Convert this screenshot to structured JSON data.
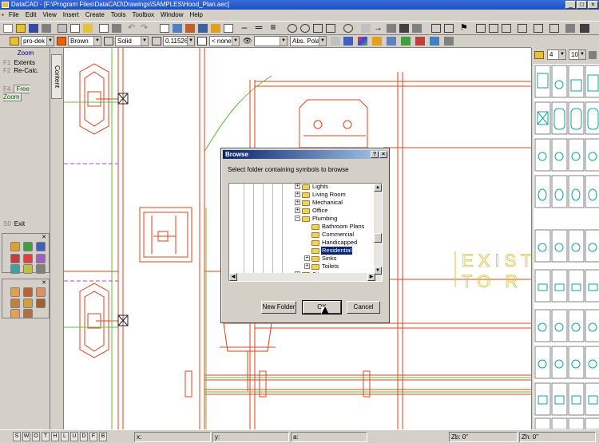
{
  "window": {
    "title": "DataCAD - [F:\\Program Files\\DataCAD\\Drawings\\SAMPLES\\Hood_Plan.aec]"
  },
  "menu": [
    "File",
    "Edit",
    "View",
    "Insert",
    "Create",
    "Tools",
    "Toolbox",
    "Window",
    "Help"
  ],
  "toolbar2": {
    "layer": "pro-dek",
    "color": "Brown",
    "linetype": "Solid",
    "lineweight": "0.115263",
    "fill": "< none >",
    "unnamed": "",
    "coords": "Abs. Polar"
  },
  "left_panel": {
    "fkeys": [
      {
        "key": "F1",
        "label": "Extents"
      },
      {
        "key": "F2",
        "label": "Re-Calc."
      },
      {
        "key": "F4",
        "label": "Free Zoom"
      },
      {
        "key": "S0",
        "label": "Exit"
      }
    ],
    "header": "Zoom",
    "tab": "Content"
  },
  "canvas": {
    "text_line1": "EXIST",
    "text_line2": "TO R"
  },
  "right_panel": {
    "column_count": "4",
    "page": "10"
  },
  "dialog": {
    "title": "Browse",
    "prompt": "Select folder containing symbols to browse",
    "tree": [
      {
        "label": "Lights",
        "level": 0,
        "expander": "+"
      },
      {
        "label": "Living Room",
        "level": 0,
        "expander": "+"
      },
      {
        "label": "Mechanical",
        "level": 0,
        "expander": "+"
      },
      {
        "label": "Office",
        "level": 0,
        "expander": "+"
      },
      {
        "label": "Plumbing",
        "level": 0,
        "expander": "-"
      },
      {
        "label": "Bathroom Plans",
        "level": 1,
        "expander": ""
      },
      {
        "label": "Commercial",
        "level": 1,
        "expander": ""
      },
      {
        "label": "Handicapped",
        "level": 1,
        "expander": ""
      },
      {
        "label": "Residential",
        "level": 1,
        "expander": "",
        "selected": true
      },
      {
        "label": "Sinks",
        "level": 1,
        "expander": "+"
      },
      {
        "label": "Toilets",
        "level": 1,
        "expander": "+"
      },
      {
        "label": "Site",
        "level": 0,
        "expander": "+"
      }
    ],
    "buttons": {
      "new_folder": "New Folder",
      "ok": "OK",
      "cancel": "Cancel"
    },
    "help": "?",
    "close": "×"
  },
  "status": {
    "keys": [
      "S",
      "W",
      "O",
      "T",
      "H",
      "L",
      "U",
      "D",
      "F",
      "B"
    ],
    "x": "x:",
    "y": "y:",
    "a": "a:",
    "zb": "Zb: 0\"",
    "zh": "Zh: 0\""
  },
  "colors": {
    "cad_red": "#e0401a",
    "cad_green": "#5cbf3a",
    "symbol_teal": "#12a3a3",
    "cad_yellow": "#d8c23a"
  }
}
